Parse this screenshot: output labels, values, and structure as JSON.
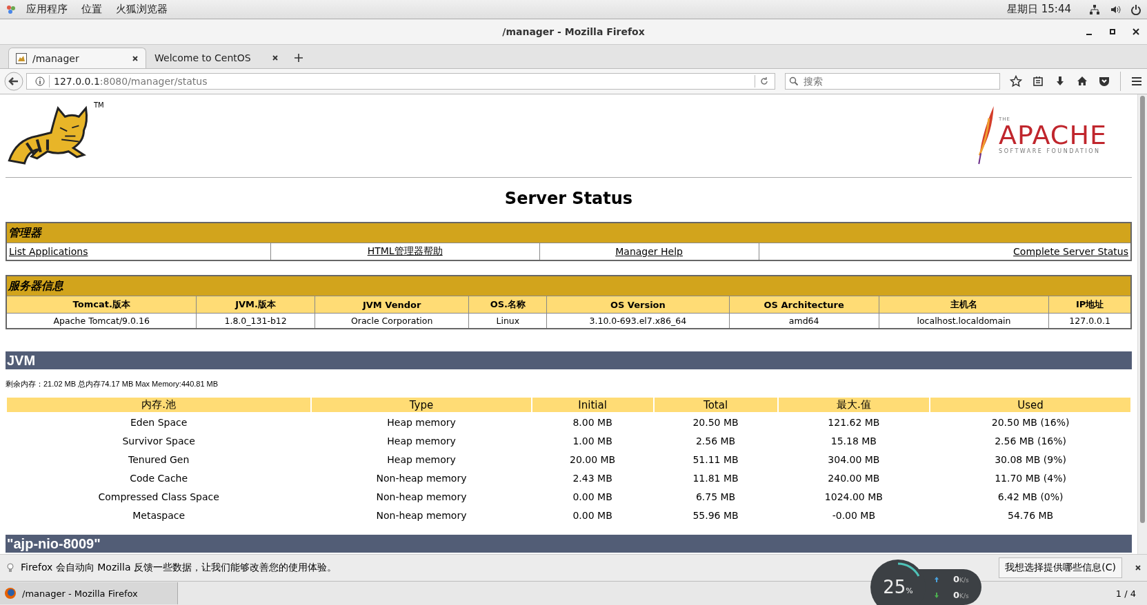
{
  "top_bar": {
    "menus": [
      "应用程序",
      "位置",
      "火狐浏览器"
    ],
    "clock": "星期日 15:44"
  },
  "window": {
    "title": "/manager - Mozilla Firefox"
  },
  "tabs": [
    {
      "label": "/manager",
      "selected": true
    },
    {
      "label": "Welcome to CentOS",
      "selected": false
    }
  ],
  "address_bar": {
    "host": "127.0.0.1",
    "path": ":8080/manager/status"
  },
  "search": {
    "placeholder": "搜索"
  },
  "page": {
    "tomcat_mark": "TM",
    "apache_logo": {
      "the": "THE",
      "name": "APACHE",
      "sub": "SOFTWARE FOUNDATION"
    },
    "heading": "Server Status",
    "manager": {
      "title": "管理器",
      "links": [
        "List Applications",
        "HTML管理器帮助",
        "Manager Help",
        "Complete Server Status"
      ]
    },
    "server_info": {
      "title": "服务器信息",
      "columns": [
        "Tomcat.版本",
        "JVM.版本",
        "JVM Vendor",
        "OS.名称",
        "OS Version",
        "OS Architecture",
        "主机名",
        "IP地址"
      ],
      "row": [
        "Apache Tomcat/9.0.16",
        "1.8.0_131-b12",
        "Oracle Corporation",
        "Linux",
        "3.10.0-693.el7.x86_64",
        "amd64",
        "localhost.localdomain",
        "127.0.0.1"
      ]
    },
    "jvm": {
      "title": "JVM",
      "memory": "剩余内存：21.02 MB 总内存74.17 MB Max Memory:440.81 MB",
      "columns": [
        "内存.池",
        "Type",
        "Initial",
        "Total",
        "最大.值",
        "Used"
      ],
      "rows": [
        [
          "Eden Space",
          "Heap memory",
          "8.00 MB",
          "20.50 MB",
          "121.62 MB",
          "20.50 MB (16%)"
        ],
        [
          "Survivor Space",
          "Heap memory",
          "1.00 MB",
          "2.56 MB",
          "15.18 MB",
          "2.56 MB (16%)"
        ],
        [
          "Tenured Gen",
          "Heap memory",
          "20.00 MB",
          "51.11 MB",
          "304.00 MB",
          "30.08 MB (9%)"
        ],
        [
          "Code Cache",
          "Non-heap memory",
          "2.43 MB",
          "11.81 MB",
          "240.00 MB",
          "11.70 MB (4%)"
        ],
        [
          "Compressed Class Space",
          "Non-heap memory",
          "0.00 MB",
          "6.75 MB",
          "1024.00 MB",
          "6.42 MB (0%)"
        ],
        [
          "Metaspace",
          "Non-heap memory",
          "0.00 MB",
          "55.96 MB",
          "-0.00 MB",
          "54.76 MB"
        ]
      ]
    },
    "connector": {
      "title": "\"ajp-nio-8009\""
    }
  },
  "notification": {
    "text": "Firefox 会自动向 Mozilla 反馈一些数据，让我们能够改善您的使用体验。",
    "button": "我想选择提供哪些信息(C)"
  },
  "net_widget": {
    "percent": "25",
    "percent_unit": "%",
    "up": "0",
    "up_unit": "K/s",
    "down": "0",
    "down_unit": "K/s"
  },
  "taskbar": {
    "window": "/manager - Mozilla Firefox",
    "pager": "1 / 4"
  }
}
